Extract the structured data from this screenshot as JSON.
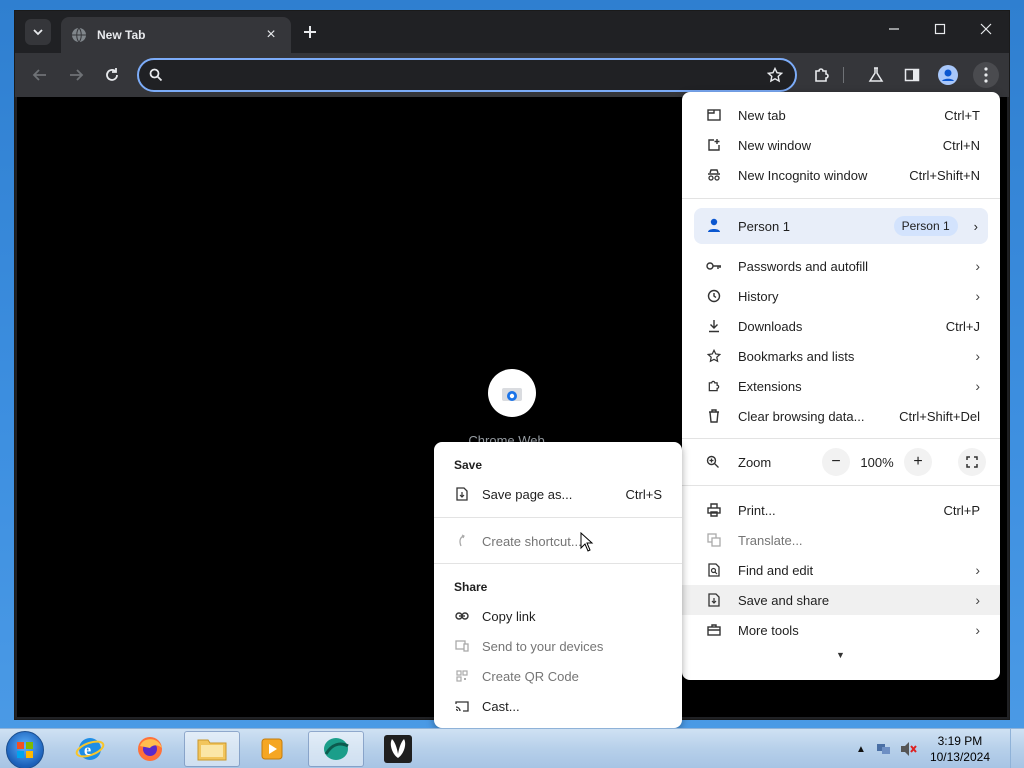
{
  "browser": {
    "tab_title": "New Tab",
    "omnibox_value": "",
    "shortcut_label": "Chrome Web..."
  },
  "menu": {
    "items": [
      {
        "label": "New tab",
        "shortcut": "Ctrl+T"
      },
      {
        "label": "New window",
        "shortcut": "Ctrl+N"
      },
      {
        "label": "New Incognito window",
        "shortcut": "Ctrl+Shift+N"
      }
    ],
    "profile": {
      "label": "Person 1",
      "chip": "Person 1"
    },
    "items2": [
      {
        "label": "Passwords and autofill",
        "shortcut": ""
      },
      {
        "label": "History",
        "shortcut": ""
      },
      {
        "label": "Downloads",
        "shortcut": "Ctrl+J"
      },
      {
        "label": "Bookmarks and lists",
        "shortcut": ""
      },
      {
        "label": "Extensions",
        "shortcut": ""
      },
      {
        "label": "Clear browsing data...",
        "shortcut": "Ctrl+Shift+Del"
      }
    ],
    "zoom": {
      "label": "Zoom",
      "minus": "−",
      "value": "100%",
      "plus": "+"
    },
    "items3": [
      {
        "label": "Print...",
        "shortcut": "Ctrl+P"
      },
      {
        "label": "Translate...",
        "shortcut": ""
      },
      {
        "label": "Find and edit",
        "shortcut": ""
      },
      {
        "label": "Save and share",
        "shortcut": ""
      },
      {
        "label": "More tools",
        "shortcut": ""
      }
    ]
  },
  "submenu": {
    "save_header": "Save",
    "save_page": {
      "label": "Save page as...",
      "shortcut": "Ctrl+S"
    },
    "create_shortcut": "Create shortcut...",
    "share_header": "Share",
    "copy_link": "Copy link",
    "send_devices": "Send to your devices",
    "qr_code": "Create QR Code",
    "cast": "Cast..."
  },
  "taskbar": {
    "time": "3:19 PM",
    "date": "10/13/2024"
  },
  "colors": {
    "accent": "#7cacf8",
    "toolbar": "#35363a",
    "tabstrip": "#202124"
  }
}
